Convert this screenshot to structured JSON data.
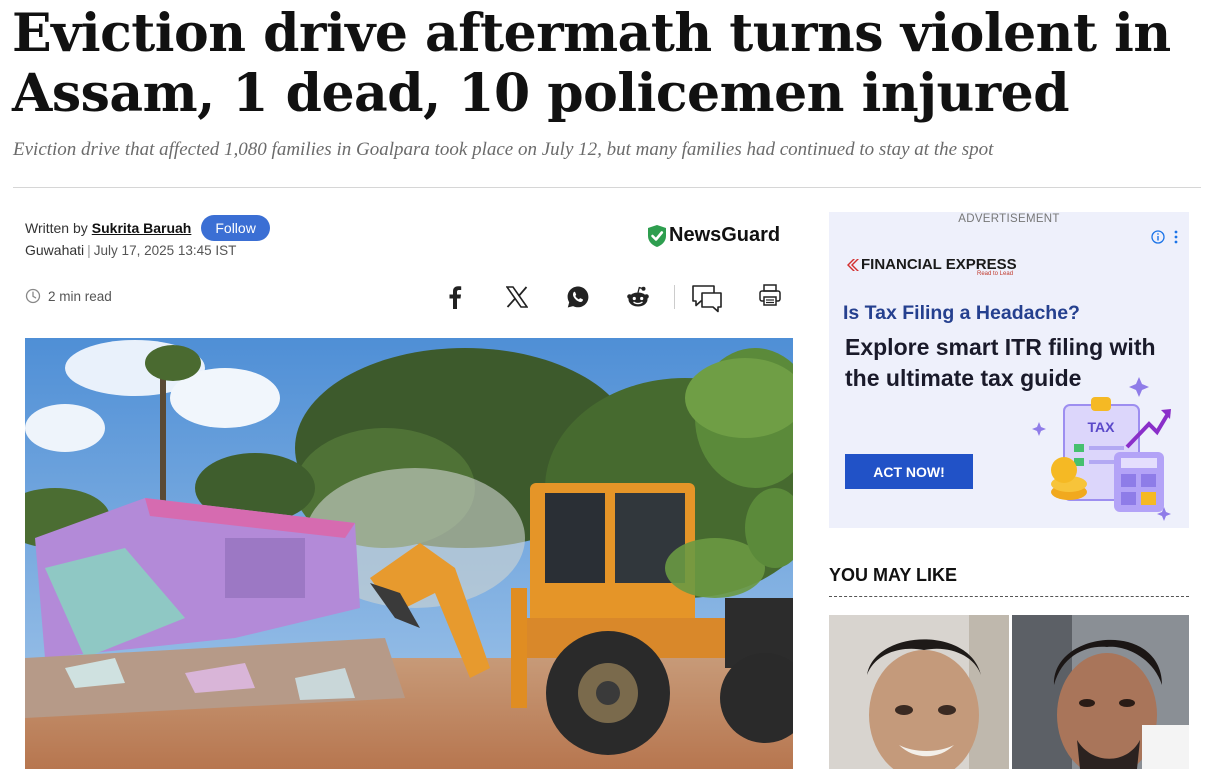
{
  "article": {
    "headline": "Eviction drive aftermath turns violent in Assam, 1 dead, 10 policemen injured",
    "subheadline": "Eviction drive that affected 1,080 families in Goalpara took place on July 12, but many families had continued to stay at the spot",
    "written_by_label": "Written by",
    "author": "Sukrita Baruah",
    "follow_label": "Follow",
    "location": "Guwahati",
    "separator": "|",
    "date": "July 17, 2025 13:45 IST",
    "newsguard_label": "NewsGuard",
    "read_time": "2 min read"
  },
  "share_icons": [
    "facebook-icon",
    "x-icon",
    "whatsapp-icon",
    "reddit-icon",
    "comments-icon",
    "print-icon"
  ],
  "ad": {
    "label": "ADVERTISEMENT",
    "brand": "FINANCIAL EXPRESS",
    "brand_tagline": "Read to Lead",
    "question": "Is Tax Filing a Headache?",
    "body": "Explore smart ITR filing with the ultimate tax guide",
    "cta": "ACT NOW!",
    "illustration_label": "TAX"
  },
  "you_may_like": {
    "title": "YOU MAY LIKE"
  },
  "colors": {
    "follow_button": "#3b6fd4",
    "newsguard_green": "#2e9e4f",
    "ad_background": "#eef0fb",
    "ad_cta": "#2152c7",
    "ad_question": "#25408f"
  }
}
